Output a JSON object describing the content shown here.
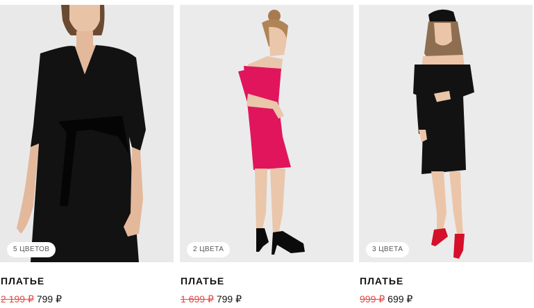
{
  "products": [
    {
      "badge": "5 ЦВЕТОВ",
      "title": "ПЛАТЬЕ",
      "old_price": "2 199 ₽",
      "price": "799 ₽",
      "dress_color": "#121212"
    },
    {
      "badge": "2 ЦВЕТА",
      "title": "ПЛАТЬЕ",
      "old_price": "1 699 ₽",
      "price": "799 ₽",
      "dress_color": "#e0155c"
    },
    {
      "badge": "3 ЦВЕТА",
      "title": "ПЛАТЬЕ",
      "old_price": "999 ₽",
      "price": "699 ₽",
      "dress_color": "#121212"
    }
  ],
  "colors": {
    "photo_background": "#ebebec",
    "old_price": "#e04848",
    "text": "#111111"
  }
}
